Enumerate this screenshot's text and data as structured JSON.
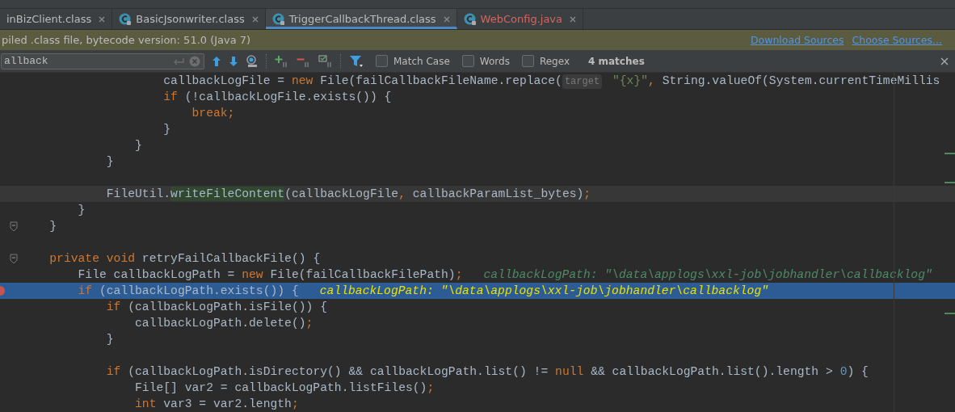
{
  "tabs": [
    {
      "label": "inBizClient.class",
      "selected": false,
      "color": "#bbbbbb",
      "icon": false
    },
    {
      "label": "BasicJsonwriter.class",
      "selected": false,
      "color": "#bbbbbb",
      "icon": true
    },
    {
      "label": "TriggerCallbackThread.class",
      "selected": true,
      "color": "#bbbbbb",
      "icon": true
    },
    {
      "label": "WebConfig.java",
      "selected": false,
      "color": "#d0685f",
      "icon": true
    }
  ],
  "banner": {
    "text": "piled .class file, bytecode version: 51.0 (Java 7)",
    "links": [
      "Download Sources",
      "Choose Sources..."
    ]
  },
  "find_bar": {
    "value": "allback",
    "options": [
      {
        "label": "Match Case",
        "checked": false
      },
      {
        "label": "Words",
        "checked": false
      },
      {
        "label": "Regex",
        "checked": false
      }
    ],
    "matches": "4 matches"
  },
  "code_lines": [
    {
      "current": false,
      "selected": false,
      "breakpoint": false,
      "fold": false,
      "tokens": [
        {
          "kind": "plain",
          "text": "                    callbackLogFile = "
        },
        {
          "kind": "kw",
          "text": "new"
        },
        {
          "kind": "plain",
          "text": " File(failCallbackFileName.replace("
        },
        {
          "kind": "hint",
          "text": "target"
        },
        {
          "kind": "str",
          "text": " \"{x}\""
        },
        {
          "kind": "kw",
          "text": ", "
        },
        {
          "kind": "plain",
          "text": "String.valueOf(System.currentTimeMillis"
        }
      ]
    },
    {
      "current": false,
      "selected": false,
      "breakpoint": false,
      "fold": false,
      "tokens": [
        {
          "kind": "kw",
          "text": "                    if"
        },
        {
          "kind": "plain",
          "text": " (!callbackLogFile.exists()) {"
        }
      ]
    },
    {
      "current": false,
      "selected": false,
      "breakpoint": false,
      "fold": false,
      "tokens": [
        {
          "kind": "kw",
          "text": "                        break;"
        }
      ]
    },
    {
      "current": false,
      "selected": false,
      "breakpoint": false,
      "fold": false,
      "tokens": [
        {
          "kind": "plain",
          "text": "                    }"
        }
      ]
    },
    {
      "current": false,
      "selected": false,
      "breakpoint": false,
      "fold": false,
      "tokens": [
        {
          "kind": "plain",
          "text": "                }"
        }
      ]
    },
    {
      "current": false,
      "selected": false,
      "breakpoint": false,
      "fold": false,
      "tokens": [
        {
          "kind": "plain",
          "text": "            }"
        }
      ]
    },
    {
      "current": false,
      "selected": false,
      "breakpoint": false,
      "fold": false
    },
    {
      "current": true,
      "selected": false,
      "breakpoint": false,
      "fold": false,
      "tokens": [
        {
          "kind": "plain",
          "text": "            FileUtil."
        },
        {
          "kind": "match",
          "text": "writeFileContent"
        },
        {
          "kind": "plain",
          "text": "(callbackLogFile"
        },
        {
          "kind": "kw",
          "text": ", "
        },
        {
          "kind": "plain",
          "text": "callbackParamList_bytes)"
        },
        {
          "kind": "kw",
          "text": ";"
        }
      ]
    },
    {
      "current": false,
      "selected": false,
      "breakpoint": false,
      "fold": false,
      "tokens": [
        {
          "kind": "plain",
          "text": "        }"
        }
      ]
    },
    {
      "current": false,
      "selected": false,
      "breakpoint": false,
      "fold": true,
      "tokens": [
        {
          "kind": "plain",
          "text": "    }"
        }
      ]
    },
    {
      "current": false,
      "selected": false,
      "breakpoint": false,
      "fold": false
    },
    {
      "current": false,
      "selected": false,
      "breakpoint": false,
      "fold": true,
      "tokens": [
        {
          "kind": "kw",
          "text": "    private void "
        },
        {
          "kind": "plain",
          "text": "retryFailCallbackFile() {"
        }
      ]
    },
    {
      "current": false,
      "selected": false,
      "breakpoint": false,
      "fold": false,
      "tokens": [
        {
          "kind": "plain",
          "text": "        File callbackLogPath = "
        },
        {
          "kind": "kw",
          "text": "new "
        },
        {
          "kind": "plain",
          "text": "File(failCallbackFilePath)"
        },
        {
          "kind": "kw",
          "text": ";"
        },
        {
          "kind": "debug",
          "text": "callbackLogPath: \"\\data\\applogs\\xxl-job\\jobhandler\\callbacklog\""
        }
      ]
    },
    {
      "current": false,
      "selected": true,
      "breakpoint": true,
      "fold": false,
      "tokens": [
        {
          "kind": "kw",
          "text": "        if"
        },
        {
          "kind": "plain",
          "text": " (callbackLogPath.exists()) {"
        },
        {
          "kind": "debug",
          "text": "callbackLogPath: \"\\data\\applogs\\xxl-job\\jobhandler\\callbacklog\""
        }
      ]
    },
    {
      "current": false,
      "selected": false,
      "breakpoint": false,
      "fold": false,
      "tokens": [
        {
          "kind": "kw",
          "text": "            if"
        },
        {
          "kind": "plain",
          "text": " (callbackLogPath.isFile()) {"
        }
      ]
    },
    {
      "current": false,
      "selected": false,
      "breakpoint": false,
      "fold": false,
      "tokens": [
        {
          "kind": "plain",
          "text": "                callbackLogPath.delete()"
        },
        {
          "kind": "kw",
          "text": ";"
        }
      ]
    },
    {
      "current": false,
      "selected": false,
      "breakpoint": false,
      "fold": false,
      "tokens": [
        {
          "kind": "plain",
          "text": "            }"
        }
      ]
    },
    {
      "current": false,
      "selected": false,
      "breakpoint": false,
      "fold": false
    },
    {
      "current": false,
      "selected": false,
      "breakpoint": false,
      "fold": false,
      "tokens": [
        {
          "kind": "kw",
          "text": "            if"
        },
        {
          "kind": "plain",
          "text": " (callbackLogPath.isDirectory() && callbackLogPath.list() != "
        },
        {
          "kind": "kw",
          "text": "null"
        },
        {
          "kind": "plain",
          "text": " && callbackLogPath.list().length > "
        },
        {
          "kind": "num",
          "text": "0"
        },
        {
          "kind": "plain",
          "text": ") {"
        }
      ]
    },
    {
      "current": false,
      "selected": false,
      "breakpoint": false,
      "fold": false,
      "tokens": [
        {
          "kind": "plain",
          "text": "                File[] var2 = callbackLogPath.listFiles()"
        },
        {
          "kind": "kw",
          "text": ";"
        }
      ]
    },
    {
      "current": false,
      "selected": false,
      "breakpoint": false,
      "fold": false,
      "tokens": [
        {
          "kind": "kw",
          "text": "                int "
        },
        {
          "kind": "plain",
          "text": "var3 = var2.length"
        },
        {
          "kind": "kw",
          "text": ";"
        }
      ]
    }
  ]
}
